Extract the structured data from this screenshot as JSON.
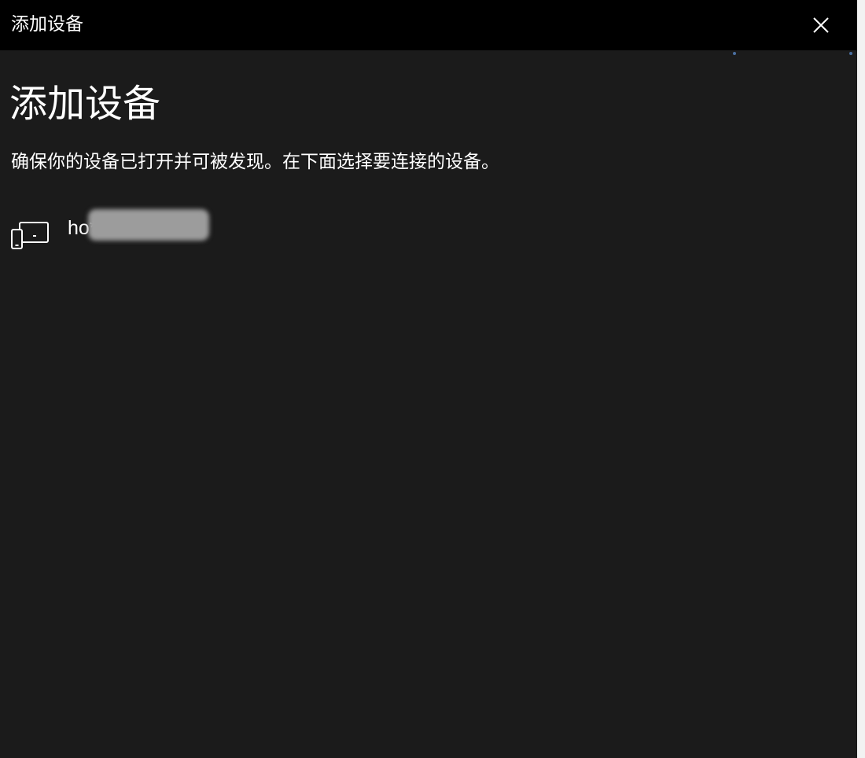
{
  "window": {
    "title": "添加设备",
    "close_icon": "close-icon"
  },
  "main": {
    "heading": "添加设备",
    "instruction": "确保你的设备已打开并可被发现。在下面选择要连接的设备。"
  },
  "devices": [
    {
      "name": "ho****-818",
      "icon": "device-icon"
    }
  ],
  "colors": {
    "titlebar": "#000000",
    "background": "#1b1b1b",
    "text": "#ffffff"
  }
}
